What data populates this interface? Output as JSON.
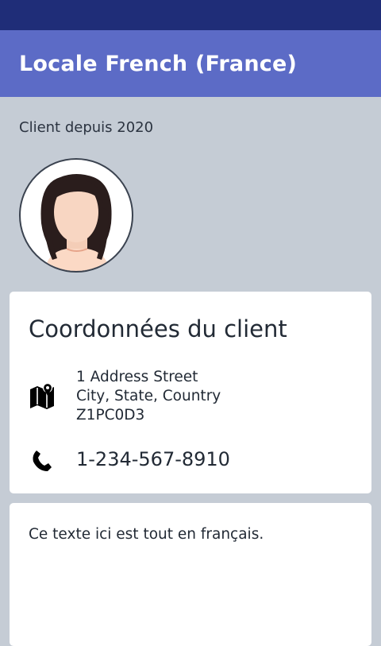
{
  "app_bar": {
    "title": "Locale French (France)"
  },
  "profile": {
    "since_text": "Client depuis 2020",
    "avatar_icon": "woman-avatar-icon"
  },
  "contact_card": {
    "heading": "Coordonnées du client",
    "address_icon": "map-icon",
    "address_lines": [
      "1 Address Street",
      "City, State, Country",
      "Z1PC0D3"
    ],
    "phone_icon": "phone-icon",
    "phone": "1-234-567-8910"
  },
  "text_card": {
    "body": "Ce texte ici est tout en français."
  },
  "colors": {
    "status_bar": "#1f2d78",
    "app_bar": "#5c6bc6",
    "background": "#c5ccd5",
    "card": "#ffffff",
    "text": "#222a35"
  }
}
